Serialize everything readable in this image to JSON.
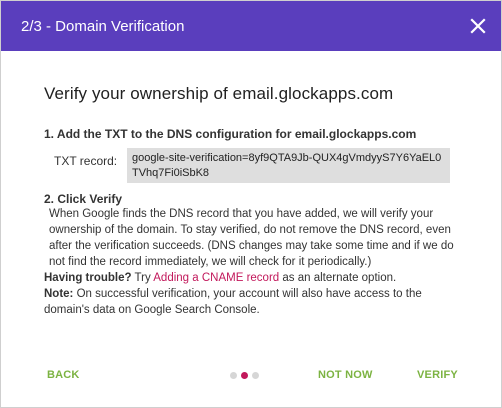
{
  "dialog": {
    "title": "2/3 - Domain Verification",
    "close_icon": "close-icon"
  },
  "content": {
    "heading": "Verify your ownership of email.glockapps.com",
    "step1": {
      "title": "1. Add the TXT to the DNS configuration for email.glockapps.com",
      "label": "TXT record:",
      "value": "google-site-verification=8yf9QTA9Jb-QUX4gVmdyyS7Y6YaEL0TVhq7Fi0iSbK8"
    },
    "step2": {
      "title": "2. Click Verify",
      "description": "When Google finds the DNS record that you have added, we will verify your ownership of the domain. To stay verified, do not remove the DNS record, even after the verification succeeds. (DNS changes may take some time and if we do not find the record immediately, we will check for it periodically.)"
    },
    "trouble": {
      "label": "Having trouble?",
      "prefix": " Try ",
      "link": "Adding a CNAME record",
      "suffix": " as an alternate option."
    },
    "note": {
      "label": "Note:",
      "text": " On successful verification, your account will also have access to the domain's data on Google Search Console."
    }
  },
  "footer": {
    "back_label": "BACK",
    "not_now_label": "NOT NOW",
    "verify_label": "VERIFY",
    "progress": {
      "total": 3,
      "current": 2
    }
  },
  "colors": {
    "header": "#5a3ebd",
    "button_text": "#7cb342",
    "link": "#c2185b",
    "dot_active": "#c2185b",
    "dot_inactive": "#d6d6d6",
    "record_bg": "#dedede"
  }
}
